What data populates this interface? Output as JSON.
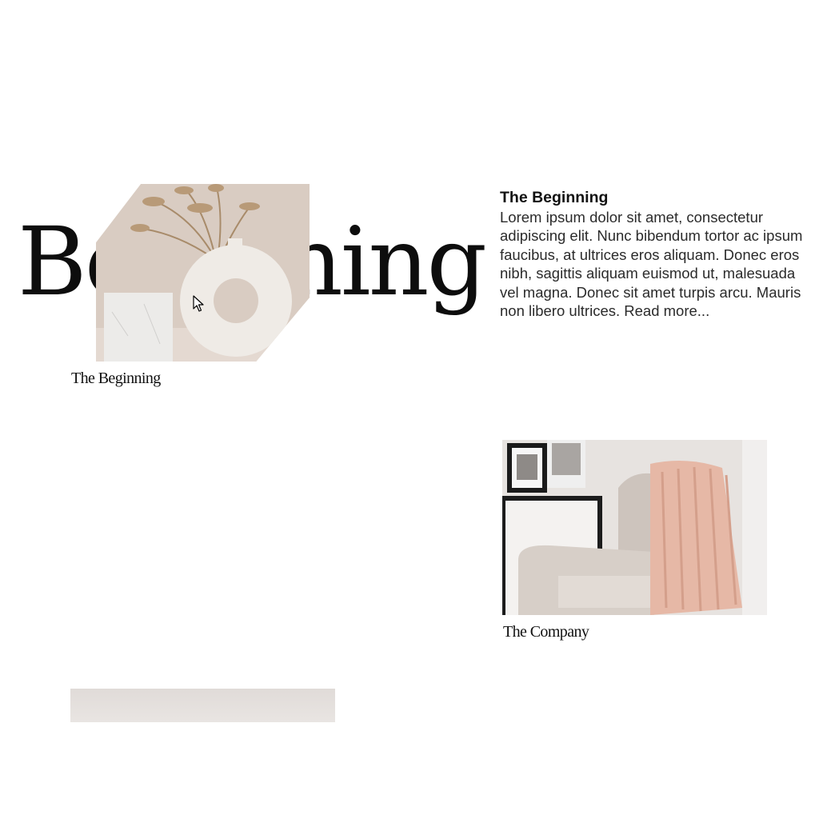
{
  "hero": {
    "display_title": "Beginning",
    "caption": "The Beginning",
    "image_icon": "vase-photo"
  },
  "article": {
    "heading": "The Beginning",
    "body": "Lorem ipsum dolor sit amet, consectetur adipiscing elit. Nunc bibendum tortor ac ipsum faucibus, at ultrices eros aliquam. Donec eros nibh, sagittis aliquam euismod ut, malesuada vel magna. Donec sit amet turpis arcu. Mauris non libero ultrices.",
    "read_more": "Read more..."
  },
  "company": {
    "caption": "The Company",
    "image_icon": "armchair-photo"
  },
  "colors": {
    "background": "#ffffff",
    "text": "#111111",
    "accent_beige": "#d8cbc1",
    "blush": "#e8b9a8"
  },
  "cursor": {
    "icon": "arrow-cursor-icon"
  }
}
